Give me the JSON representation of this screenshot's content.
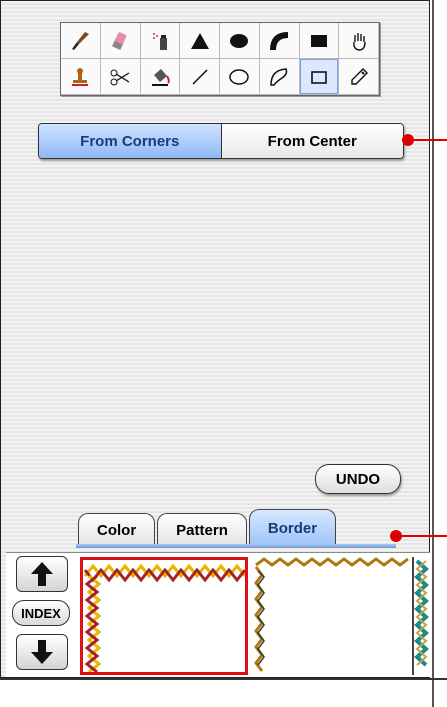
{
  "tool_palette": {
    "tools": [
      {
        "name": "paintbrush-icon"
      },
      {
        "name": "eraser-icon"
      },
      {
        "name": "spray-can-icon"
      },
      {
        "name": "triangle-icon"
      },
      {
        "name": "oval-fill-icon"
      },
      {
        "name": "arc-icon"
      },
      {
        "name": "rectangle-fill-icon"
      },
      {
        "name": "hand-icon"
      },
      {
        "name": "stamp-icon"
      },
      {
        "name": "scissors-icon"
      },
      {
        "name": "paint-bucket-icon"
      },
      {
        "name": "line-icon"
      },
      {
        "name": "oval-outline-icon"
      },
      {
        "name": "freeform-icon"
      },
      {
        "name": "rectangle-outline-icon"
      },
      {
        "name": "eyedropper-icon"
      }
    ],
    "selected_index": 14
  },
  "draw_mode": {
    "options": [
      "From Corners",
      "From Center"
    ],
    "selected": "From Corners"
  },
  "undo_label": "UNDO",
  "tabs": [
    "Color",
    "Pattern",
    "Border"
  ],
  "active_tab": "Border",
  "index_label": "INDEX",
  "colors": {
    "accent": "#8fb9f5",
    "callout": "#dd0000",
    "selection": "#dd1111"
  }
}
